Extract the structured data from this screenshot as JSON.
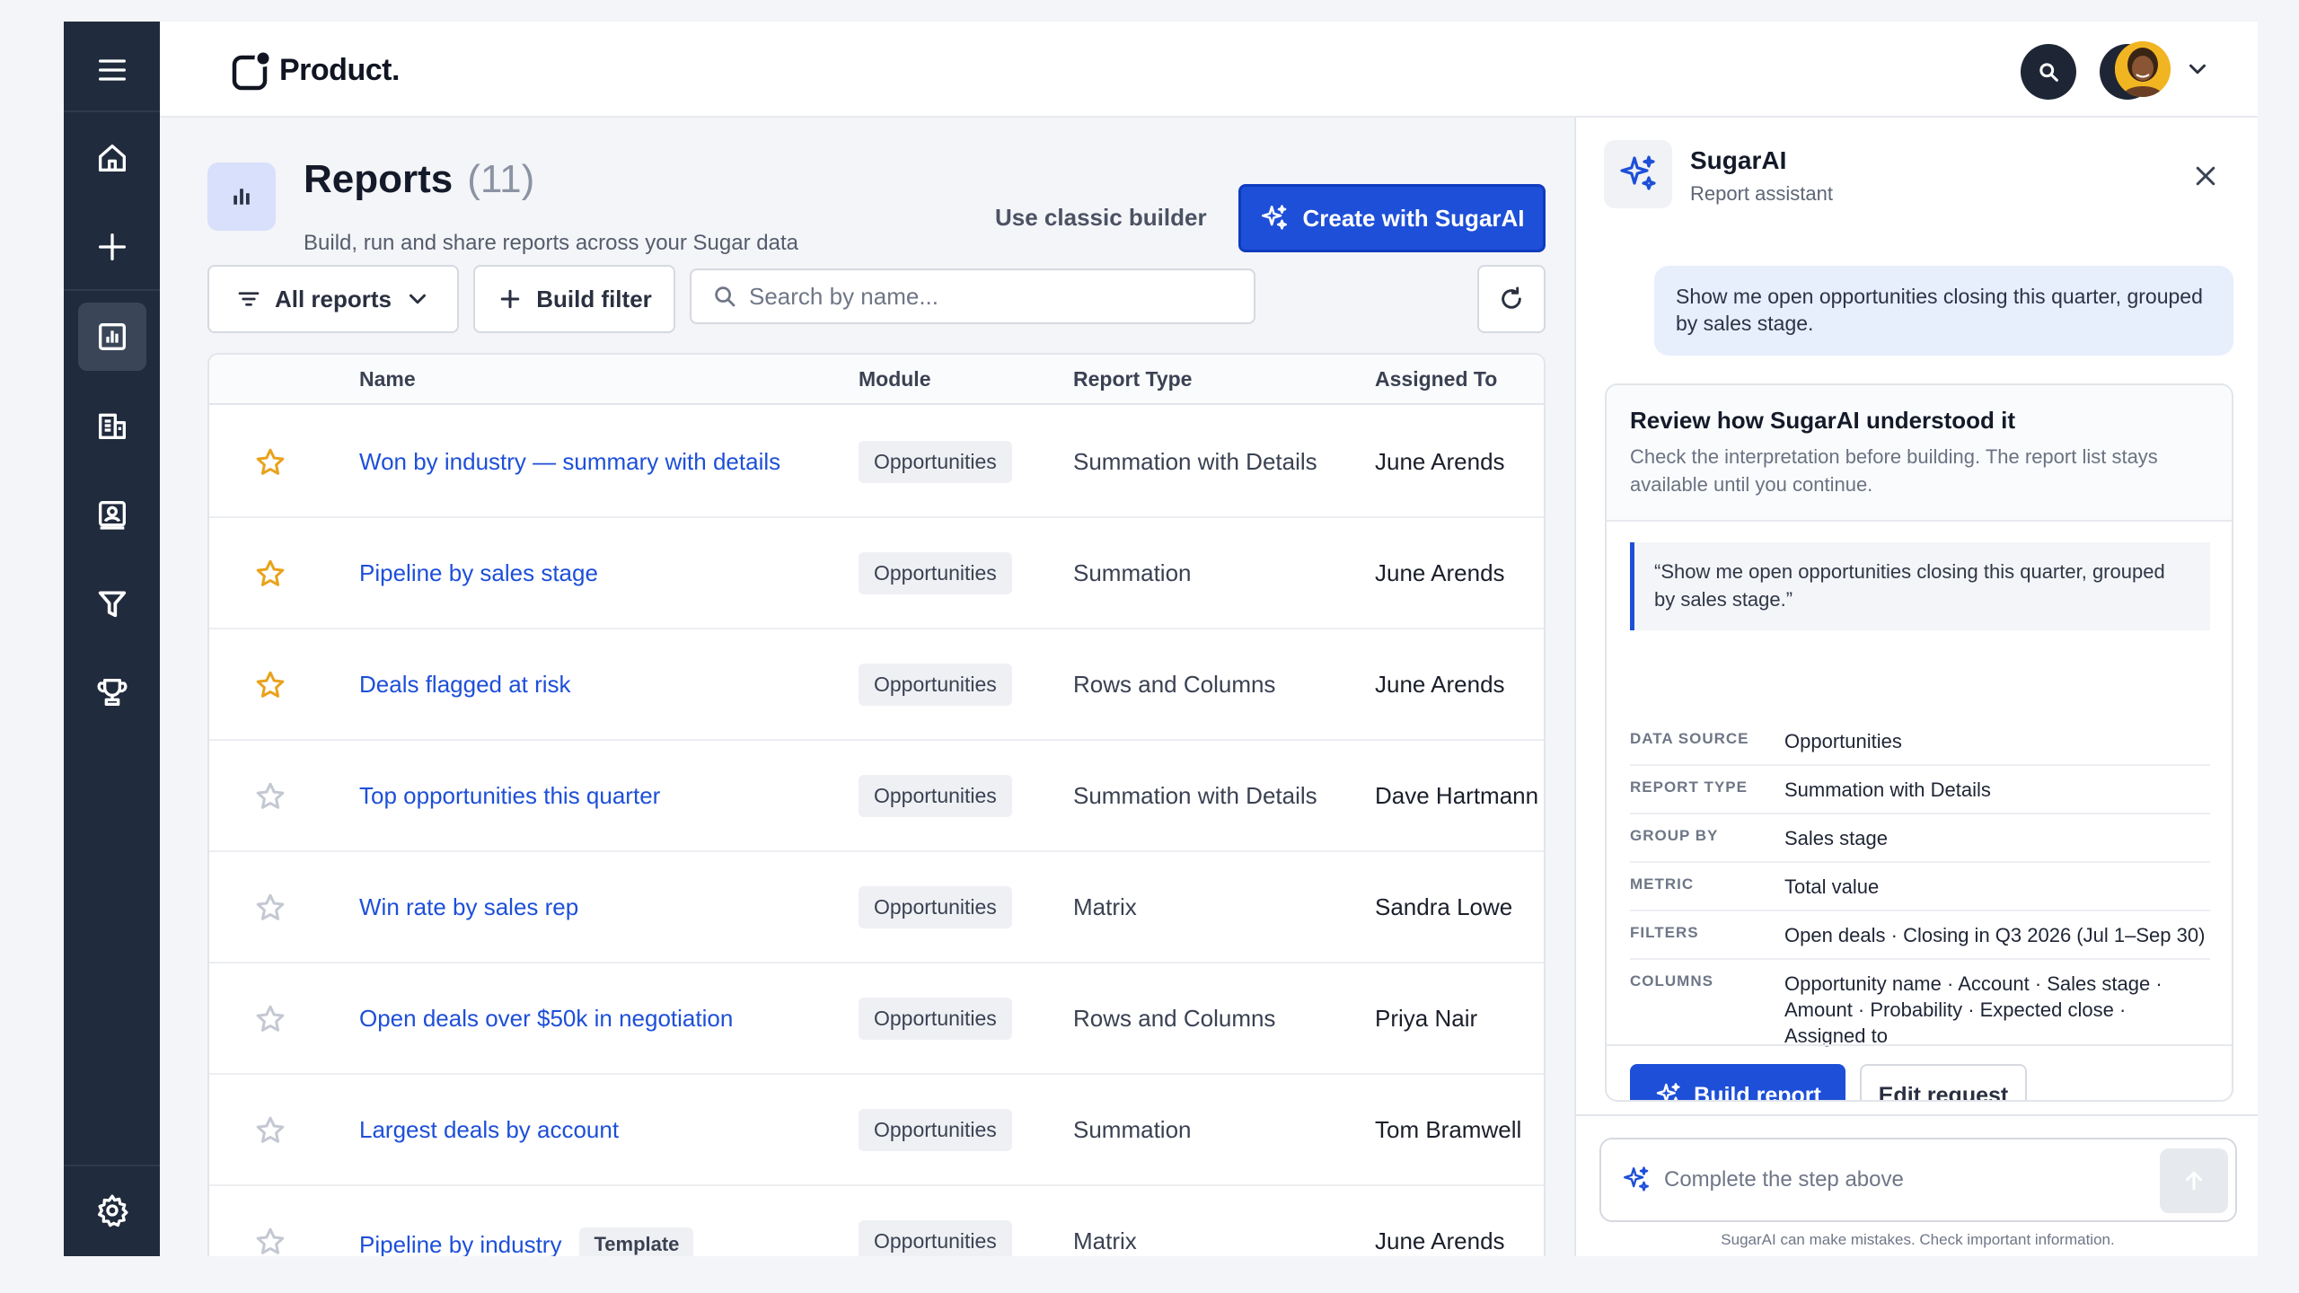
{
  "brand": {
    "name": "Product."
  },
  "nav": {
    "items": [
      {
        "icon": "menu-icon"
      },
      {
        "icon": "home-icon"
      },
      {
        "icon": "plus-icon"
      },
      {
        "icon": "reports-icon",
        "active": true
      },
      {
        "icon": "building-icon"
      },
      {
        "icon": "contact-card-icon"
      },
      {
        "icon": "funnel-icon"
      },
      {
        "icon": "trophy-icon"
      },
      {
        "icon": "gear-icon"
      }
    ]
  },
  "header": {
    "title": "Reports",
    "count": "(11)",
    "subtitle": "Build, run and share reports across your Sugar data",
    "classic_label": "Use classic builder",
    "create_label": "Create with SugarAI"
  },
  "toolbar": {
    "all_reports_label": "All reports",
    "build_filter_label": "Build filter",
    "search_placeholder": "Search by name..."
  },
  "table": {
    "columns": {
      "name": "Name",
      "module": "Module",
      "type": "Report Type",
      "assigned": "Assigned To"
    },
    "rows": [
      {
        "starred": true,
        "name": "Won by industry — summary with details",
        "module": "Opportunities",
        "type": "Summation with Details",
        "assigned": "June Arends"
      },
      {
        "starred": true,
        "name": "Pipeline by sales stage",
        "module": "Opportunities",
        "type": "Summation",
        "assigned": "June Arends"
      },
      {
        "starred": true,
        "name": "Deals flagged at risk",
        "module": "Opportunities",
        "type": "Rows and Columns",
        "assigned": "June Arends"
      },
      {
        "starred": false,
        "name": "Top opportunities this quarter",
        "module": "Opportunities",
        "type": "Summation with Details",
        "assigned": "Dave Hartmann"
      },
      {
        "starred": false,
        "name": "Win rate by sales rep",
        "module": "Opportunities",
        "type": "Matrix",
        "assigned": "Sandra Lowe"
      },
      {
        "starred": false,
        "name": "Open deals over $50k in negotiation",
        "module": "Opportunities",
        "type": "Rows and Columns",
        "assigned": "Priya Nair"
      },
      {
        "starred": false,
        "name": "Largest deals by account",
        "module": "Opportunities",
        "type": "Summation",
        "assigned": "Tom Bramwell"
      },
      {
        "starred": false,
        "name": "Pipeline by industry",
        "badge": "Template",
        "module": "Opportunities",
        "type": "Matrix",
        "assigned": "June Arends"
      }
    ]
  },
  "colors": {
    "accent": "#1d4fd8",
    "nav_bg": "#202b3d",
    "star": "#e9a21b",
    "star_off": "#c3c8d2"
  },
  "assistant": {
    "title": "SugarAI",
    "subtitle": "Report assistant",
    "user_message": "Show me open opportunities closing this quarter, grouped by sales stage.",
    "card": {
      "title": "Review how SugarAI understood it",
      "description": "Check the interpretation before building. The report list stays available until you continue.",
      "quote": "“Show me open opportunities closing this quarter, grouped by sales stage.”",
      "fields": [
        {
          "key": "DATA SOURCE",
          "value": "Opportunities"
        },
        {
          "key": "REPORT TYPE",
          "value": "Summation with Details"
        },
        {
          "key": "GROUP BY",
          "value": "Sales stage"
        },
        {
          "key": "METRIC",
          "value": "Total value"
        },
        {
          "key": "FILTERS",
          "value": "Open deals · Closing in Q3 2026 (Jul 1–Sep 30)"
        },
        {
          "key": "COLUMNS",
          "value": "Opportunity name · Account · Sales stage · Amount · Probability · Expected close · Assigned to"
        }
      ],
      "build_label": "Build report",
      "edit_label": "Edit request"
    },
    "composer_placeholder": "Complete the step above",
    "disclaimer": "SugarAI can make mistakes. Check important information."
  }
}
